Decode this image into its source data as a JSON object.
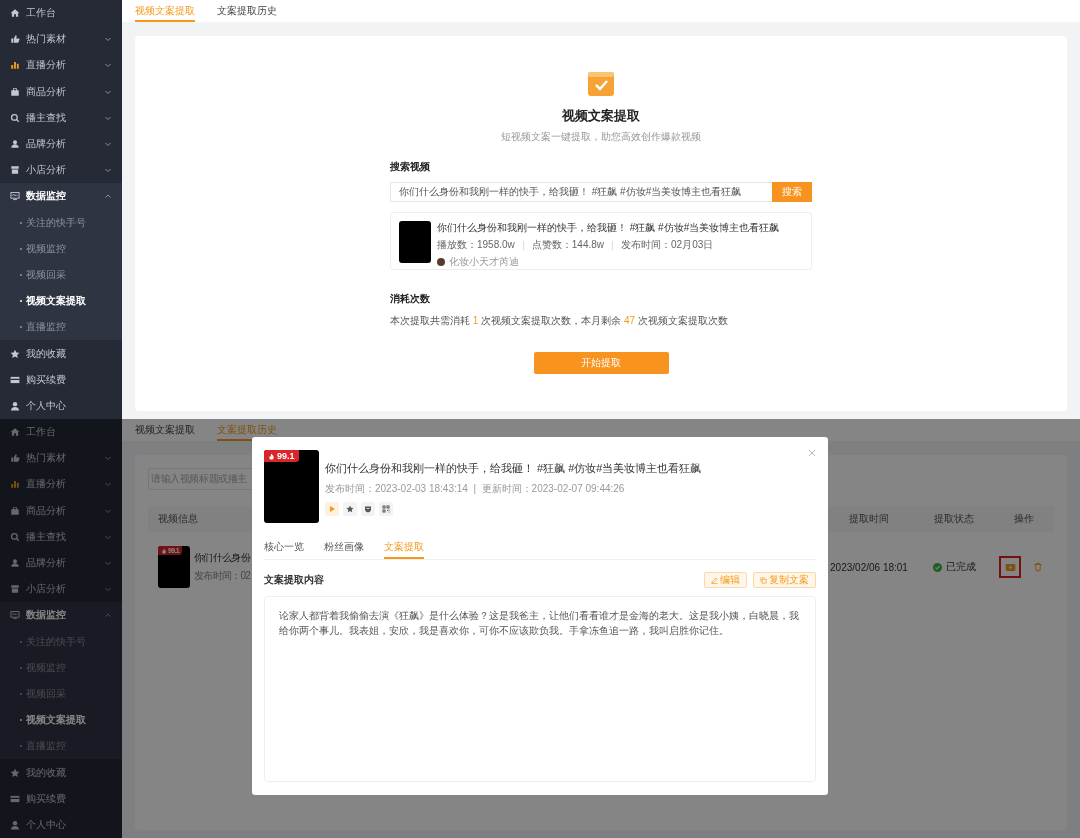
{
  "screens": [
    {
      "kind": "extract",
      "sidebar": {
        "items": [
          {
            "label": "工作台",
            "kind": "link"
          },
          {
            "label": "热门素材",
            "kind": "group",
            "expanded": false
          },
          {
            "label": "直播分析",
            "kind": "group",
            "expanded": false
          },
          {
            "label": "商品分析",
            "kind": "group",
            "expanded": false
          },
          {
            "label": "播主查找",
            "kind": "group",
            "expanded": false
          },
          {
            "label": "品牌分析",
            "kind": "group",
            "expanded": false
          },
          {
            "label": "小店分析",
            "kind": "group",
            "expanded": false
          },
          {
            "label": "数据监控",
            "kind": "group",
            "expanded": true,
            "children": [
              {
                "label": "关注的快手号",
                "selected": false
              },
              {
                "label": "视频监控",
                "selected": false
              },
              {
                "label": "视频回采",
                "selected": false
              },
              {
                "label": "视频文案提取",
                "selected": true
              },
              {
                "label": "直播监控",
                "selected": false
              }
            ]
          },
          {
            "label": "我的收藏",
            "kind": "link"
          },
          {
            "label": "购买续费",
            "kind": "link"
          },
          {
            "label": "个人中心",
            "kind": "link"
          }
        ]
      },
      "tabs": [
        {
          "label": "视频文案提取",
          "selected": true
        },
        {
          "label": "文案提取历史",
          "selected": false
        }
      ],
      "card": {
        "title": "视频文案提取",
        "subtitle": "短视频文案一键提取，助您高效创作爆款视频",
        "search_label": "搜索视频",
        "search_value": "你们什么身份和我刚一样的快手，给我砸！ #狂飙 #仿妆#当美妆博主也看狂飙",
        "search_button": "搜索",
        "result": {
          "title": "你们什么身份和我刚一样的快手，给我砸！ #狂飙 #仿妆#当美妆博主也看狂飙",
          "stats": [
            "播放数：1958.0w",
            "点赞数：144.8w",
            "发布时间：02月03日"
          ],
          "author": "化妆小天才芮迪"
        },
        "consumption_label": "消耗次数",
        "consumption_parts": [
          "本次提取共需消耗 ",
          "1",
          " 次视频文案提取次数，本月剩余 ",
          "47",
          " 次视频文案提取次数"
        ],
        "start_button": "开始提取"
      }
    },
    {
      "kind": "history",
      "sidebar": {
        "items": [
          {
            "label": "工作台",
            "kind": "link"
          },
          {
            "label": "热门素材",
            "kind": "group",
            "expanded": false
          },
          {
            "label": "直播分析",
            "kind": "group",
            "expanded": false
          },
          {
            "label": "商品分析",
            "kind": "group",
            "expanded": false
          },
          {
            "label": "播主查找",
            "kind": "group",
            "expanded": false
          },
          {
            "label": "品牌分析",
            "kind": "group",
            "expanded": false
          },
          {
            "label": "小店分析",
            "kind": "group",
            "expanded": false
          },
          {
            "label": "数据监控",
            "kind": "group",
            "expanded": true,
            "children": [
              {
                "label": "关注的快手号",
                "selected": false
              },
              {
                "label": "视频监控",
                "selected": false
              },
              {
                "label": "视频回采",
                "selected": false
              },
              {
                "label": "视频文案提取",
                "selected": true
              },
              {
                "label": "直播监控",
                "selected": false
              }
            ]
          },
          {
            "label": "我的收藏",
            "kind": "link"
          },
          {
            "label": "购买续费",
            "kind": "link"
          },
          {
            "label": "个人中心",
            "kind": "link"
          }
        ]
      },
      "tabs": [
        {
          "label": "视频文案提取",
          "selected": false
        },
        {
          "label": "文案提取历史",
          "selected": true
        }
      ],
      "search": {
        "placeholder": "请输入视频标题或播主"
      },
      "table": {
        "columns": [
          "视频信息",
          "提取时间",
          "提取状态",
          "操作"
        ],
        "rows": [
          {
            "score": "99.1",
            "title": "你们什么身份",
            "published": "发布时间：02",
            "time": "2023/02/06 18:01",
            "status": "已完成",
            "actions": [
              {
                "kind": "video",
                "highlighted": true
              },
              {
                "kind": "delete",
                "highlighted": false
              }
            ]
          }
        ]
      },
      "modal": {
        "score": "99.1",
        "title": "你们什么身份和我刚一样的快手，给我砸！ #狂飙 #仿妆#当美妆博主也看狂飙",
        "meta": "发布时间：2023-02-03 18:43:14  |  更新时间：2023-02-07 09:44:26",
        "tabs": [
          {
            "label": "核心一览",
            "selected": false
          },
          {
            "label": "粉丝画像",
            "selected": false
          },
          {
            "label": "文案提取",
            "selected": true
          }
        ],
        "section_title": "文案提取内容",
        "buttons": [
          {
            "label": "编辑",
            "kind": "edit"
          },
          {
            "label": "复制文案",
            "kind": "copy"
          }
        ],
        "content": "论家人都背着我偷偷去演《狂飙》是什么体验？这是我爸主，让他们看看谁才是金海的老大。这是我小姨，白晓晨，我给你两个事儿。我表姐，安欣，我是喜欢你，可你不应该欺负我。手拿冻鱼追一路，我叫启胜你记住。"
      }
    }
  ]
}
